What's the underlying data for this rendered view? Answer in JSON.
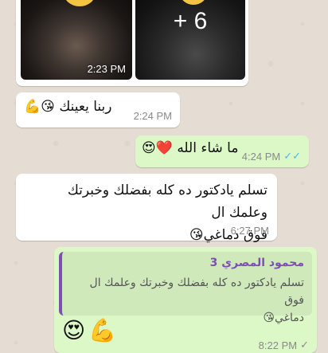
{
  "images": {
    "first": {
      "time": "2:23 PM"
    },
    "second": {
      "extra_count": "+ 6"
    }
  },
  "messages": [
    {
      "text": "ربنا يعينك",
      "emojis": [
        "😘",
        "💪"
      ],
      "time": "2:24 PM"
    },
    {
      "text": "ما شاء الله",
      "emojis": [
        "😍",
        "❤️"
      ],
      "time": "4:24 PM",
      "status": "read"
    },
    {
      "line1": "تسلم يادكتور ده كله بفضلك وخبرتك وعلمك ال",
      "line2": "فوق دماغي",
      "emoji": "😘",
      "time": "6:27 PM"
    },
    {
      "quote": {
        "author": "محمود المصري 3",
        "line1": "تسلم يادكتور ده كله بفضلك وخبرتك وعلمك ال فوق",
        "line2": "دماغي",
        "emoji": "😘"
      },
      "emojis": [
        "😍",
        "💪"
      ],
      "time": "8:22 PM",
      "status": "sent"
    }
  ],
  "icons": {
    "read_ticks": "✓✓",
    "sent_tick": "✓"
  },
  "colors": {
    "wallpaper": "#e5ddd3",
    "incoming": "#ffffff",
    "outgoing": "#dcf8c6",
    "read_tick": "#4fb6ec",
    "quote_accent": "#7d4fb3"
  }
}
